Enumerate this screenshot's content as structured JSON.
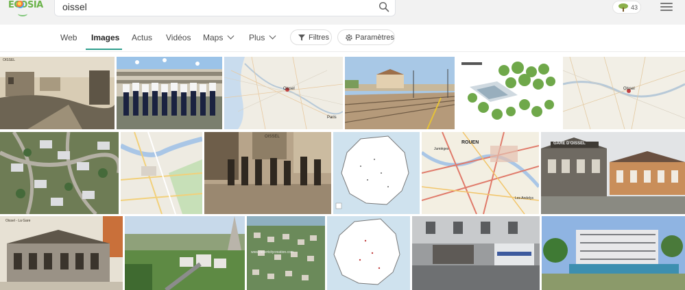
{
  "logo": {
    "text": "ECOSIA"
  },
  "search": {
    "query": "oissel",
    "placeholder": ""
  },
  "counter": {
    "value": "43"
  },
  "nav": {
    "web": "Web",
    "images": "Images",
    "actus": "Actus",
    "videos": "Vidéos",
    "maps": "Maps",
    "plus": "Plus",
    "filters": "Filtres",
    "settings": "Paramètres"
  },
  "results": {
    "watermark_oissel": "OISSEL",
    "station_sign": "GARE D'OISSEL",
    "map_city": "Oissel",
    "map_city_upper": "OISSEL",
    "rouen": "ROUEN",
    "jumieges": "Jumièges",
    "les_andelys": "Les Andelys",
    "paris": "Paris",
    "aerial_site": "www.desertcitycreation.com",
    "row3_caption": "Oissel - La Gare"
  },
  "colors": {
    "brand_green": "#6bb34a",
    "active_underline": "#2d9d8c",
    "header_bg": "#f2f2f2"
  }
}
